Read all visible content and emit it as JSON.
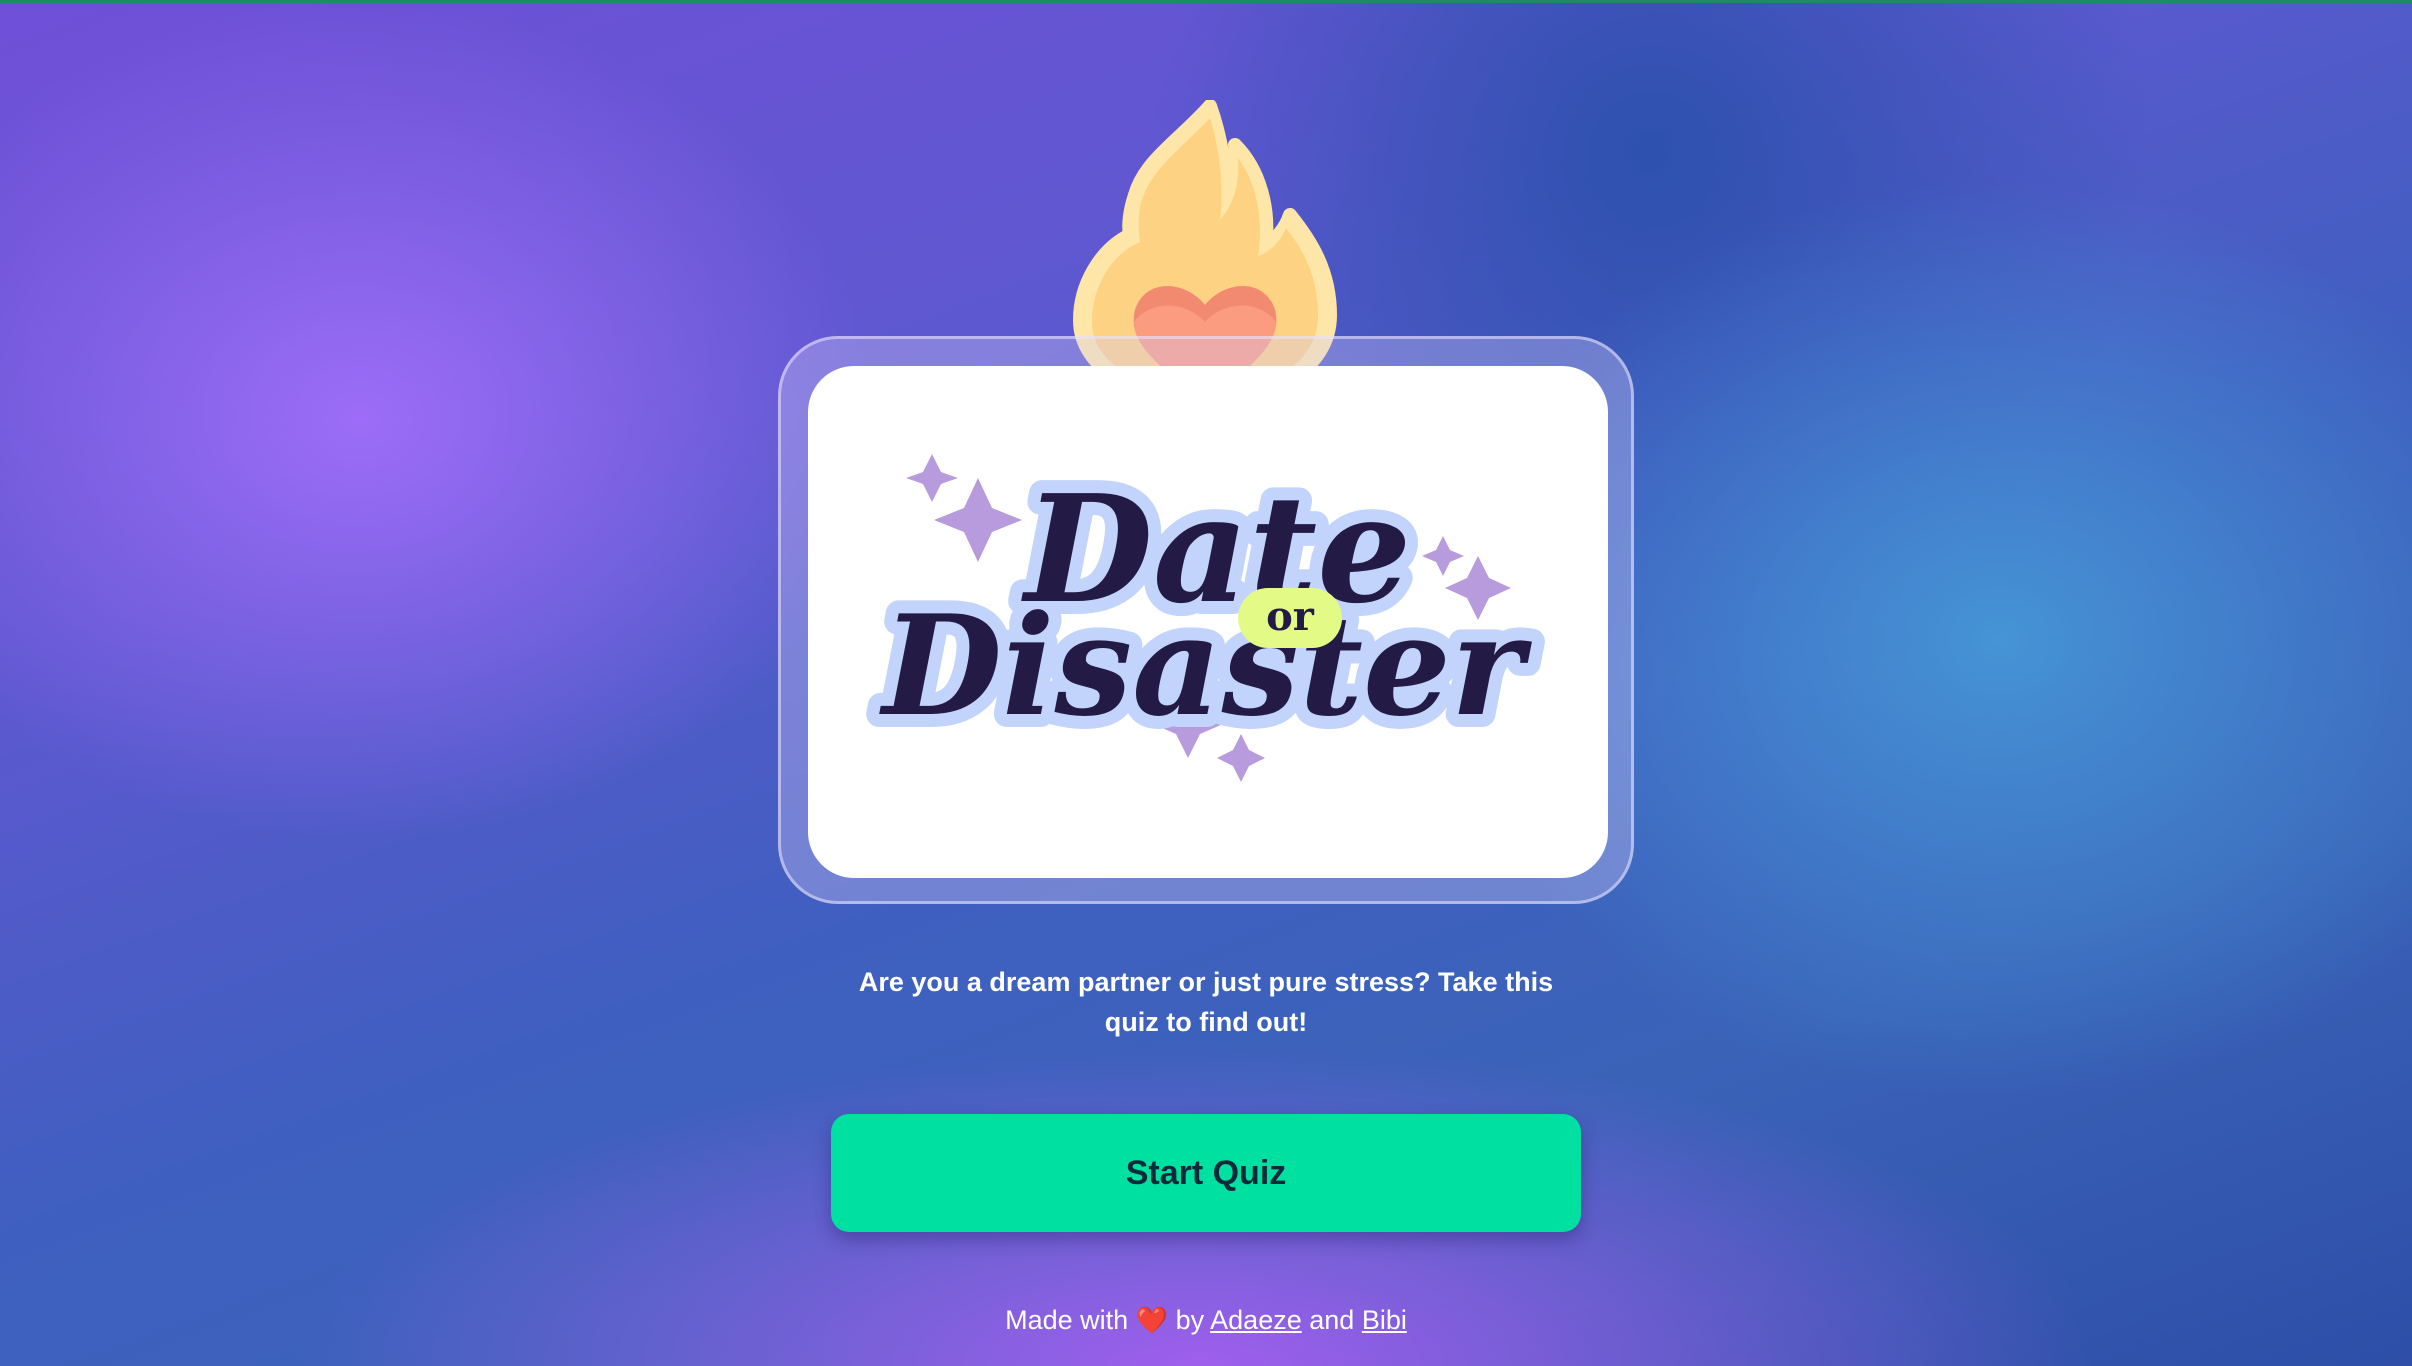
{
  "brand": {
    "logo_word_top": "Date",
    "logo_word_mid": "or",
    "logo_word_bottom": "Disaster",
    "logo_alt": "Date or Disaster logo",
    "colors": {
      "accent_button": "#00e0a0",
      "logo_text": "#231a45",
      "logo_outline": "#c2d4fb",
      "sparkle": "#b79bdc",
      "or_badge": "#e3fb86",
      "flame": "#fdd283",
      "heart": "#fb9b80"
    }
  },
  "icons": {
    "flame_heart": "flame-heart-icon",
    "footer_heart": "heart-icon"
  },
  "main": {
    "tagline": "Are you a dream partner or just pure stress? Take this quiz to find out!",
    "start_button_label": "Start Quiz"
  },
  "footer": {
    "made_with": "Made with",
    "heart_glyph": "❤️",
    "by": "by",
    "author1": "Adaeze",
    "and": "and",
    "author2": "Bibi"
  }
}
